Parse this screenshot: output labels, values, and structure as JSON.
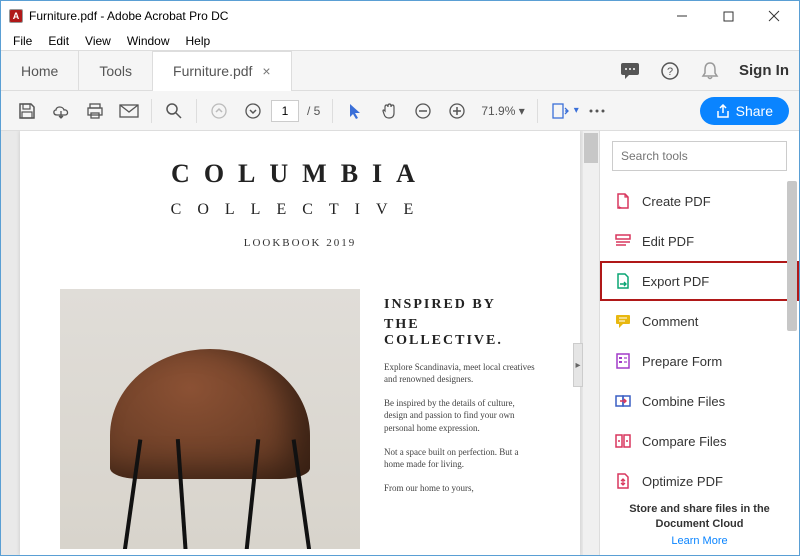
{
  "window": {
    "title": "Furniture.pdf - Adobe Acrobat Pro DC",
    "app_icon_letter": "A"
  },
  "menu": {
    "file": "File",
    "edit": "Edit",
    "view": "View",
    "window": "Window",
    "help": "Help"
  },
  "tabs": {
    "home": "Home",
    "tools": "Tools",
    "document": "Furniture.pdf"
  },
  "header": {
    "sign_in": "Sign In"
  },
  "toolbar": {
    "current_page": "1",
    "total_pages": "/ 5",
    "zoom": "71.9%",
    "share": "Share"
  },
  "document": {
    "title": "COLUMBIA",
    "subtitle": "COLLECTIVE",
    "year": "LOOKBOOK 2019",
    "heading1": "INSPIRED BY",
    "heading2": "THE COLLECTIVE.",
    "p1": "Explore Scandinavia, meet local creatives and renowned designers.",
    "p2": "Be inspired by the details of culture, design and passion to find your own personal home expression.",
    "p3": "Not a space built on perfection. But a home made for living.",
    "p4": "From our home to yours,"
  },
  "sidebar": {
    "search_placeholder": "Search tools",
    "tools": [
      {
        "label": "Create PDF",
        "color": "#d9375e"
      },
      {
        "label": "Edit PDF",
        "color": "#d9375e"
      },
      {
        "label": "Export PDF",
        "color": "#0aa574"
      },
      {
        "label": "Comment",
        "color": "#e8b810"
      },
      {
        "label": "Prepare Form",
        "color": "#a23cc9"
      },
      {
        "label": "Combine Files",
        "color": "#3a5fc4"
      },
      {
        "label": "Compare Files",
        "color": "#d9375e"
      },
      {
        "label": "Optimize PDF",
        "color": "#d9375e"
      }
    ],
    "promo": "Store and share files in the Document Cloud",
    "learn_more": "Learn More"
  }
}
